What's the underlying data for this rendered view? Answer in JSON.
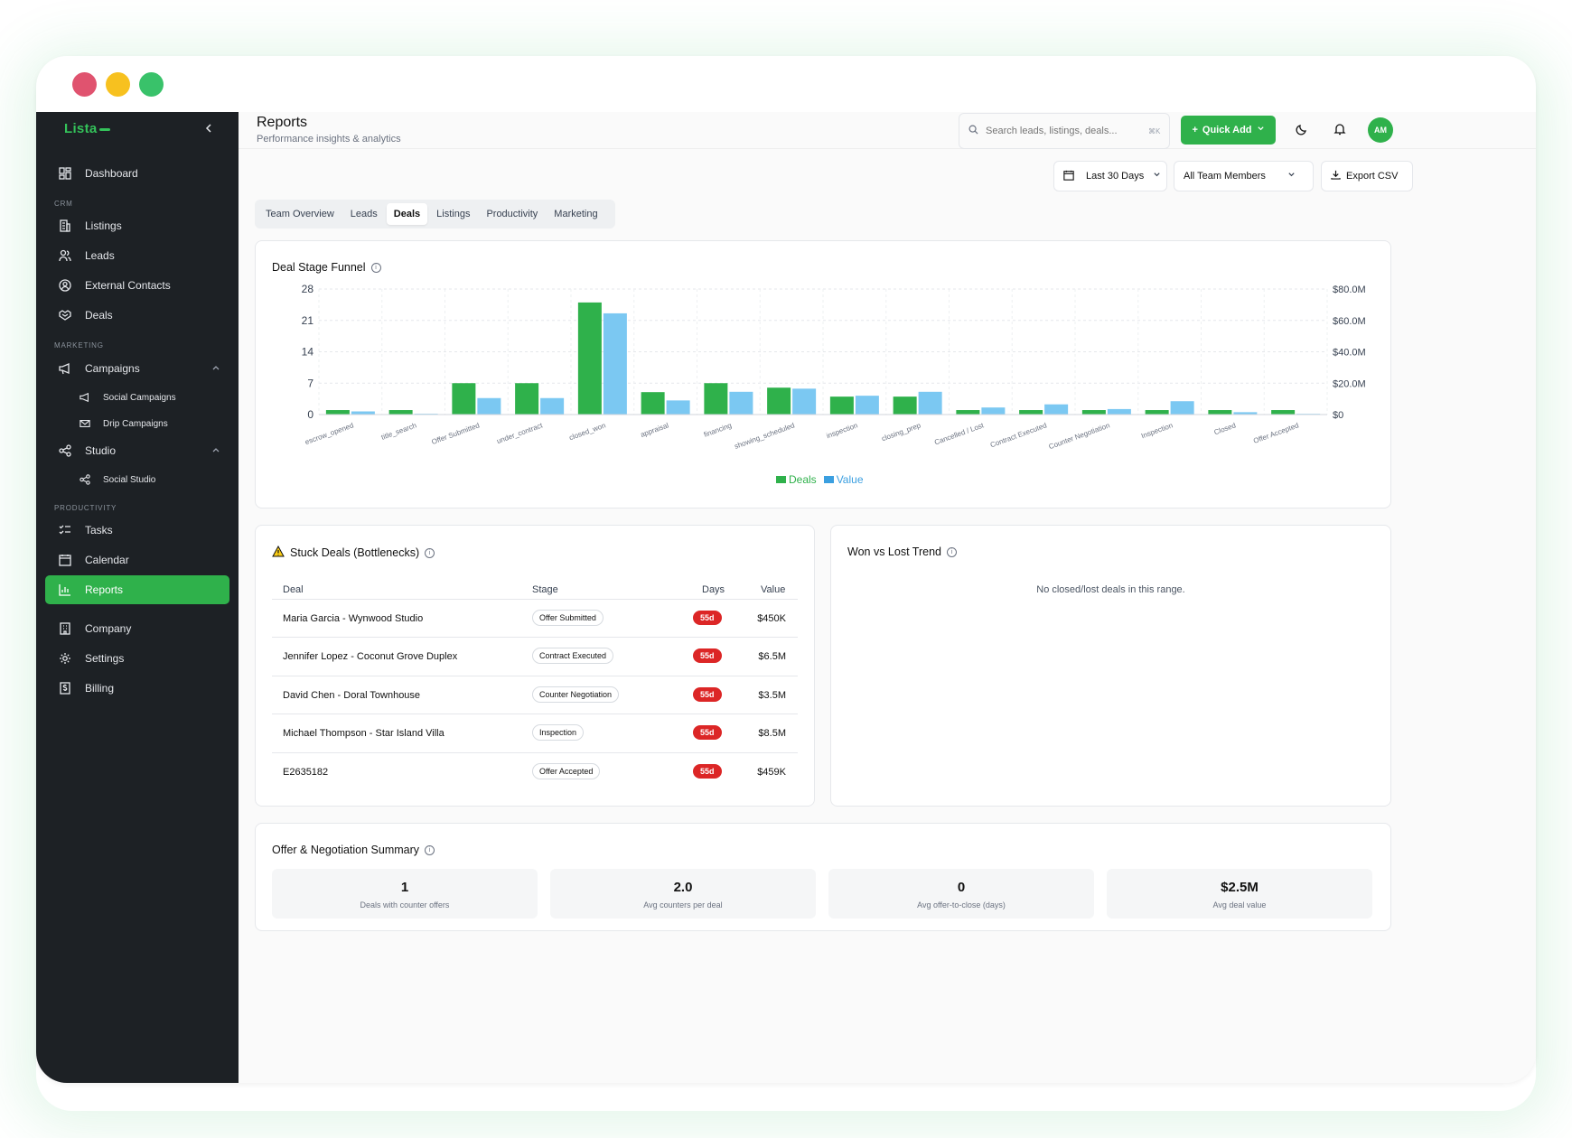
{
  "app": {
    "brand": "Lista"
  },
  "colors": {
    "accent": "#2fb14b",
    "deals": "#2fb14b",
    "value": "#7bc8f2",
    "danger": "#dc2626",
    "sidebar": "#1d2125"
  },
  "window_controls": [
    {
      "name": "close",
      "color": "#e0536f"
    },
    {
      "name": "minimize",
      "color": "#f7c11f"
    },
    {
      "name": "maximize",
      "color": "#39c26a"
    }
  ],
  "sidebar": {
    "items": [
      {
        "label": "Dashboard",
        "icon": "dashboard-icon"
      },
      {
        "section": "CRM"
      },
      {
        "label": "Listings",
        "icon": "building-icon"
      },
      {
        "label": "Leads",
        "icon": "users-icon"
      },
      {
        "label": "External Contacts",
        "icon": "contact-icon"
      },
      {
        "label": "Deals",
        "icon": "handshake-icon"
      },
      {
        "section": "MARKETING"
      },
      {
        "label": "Campaigns",
        "icon": "megaphone-icon"
      },
      {
        "label": "Social Campaigns",
        "icon": "megaphone-icon"
      },
      {
        "label": "Drip Campaigns",
        "icon": "mail-icon"
      },
      {
        "label": "Studio",
        "icon": "share-icon"
      },
      {
        "label": "Social Studio",
        "icon": "share-icon"
      },
      {
        "section": "PRODUCTIVITY"
      },
      {
        "label": "Tasks",
        "icon": "tasks-icon"
      },
      {
        "label": "Calendar",
        "icon": "calendar-icon"
      },
      {
        "label": "Reports",
        "icon": "bar-chart-icon",
        "active": true
      },
      {
        "label": "Company",
        "icon": "company-icon"
      },
      {
        "label": "Settings",
        "icon": "gear-icon"
      },
      {
        "label": "Billing",
        "icon": "billing-icon"
      }
    ]
  },
  "header": {
    "title": "Reports",
    "subtitle": "Performance insights & analytics",
    "search_placeholder": "Search leads, listings, deals...",
    "search_shortcut": "⌘K",
    "quick_add": "Quick Add",
    "avatar": "AM"
  },
  "filters": {
    "date_range": "Last 30 Days",
    "members": "All Team Members",
    "export": "Export CSV"
  },
  "tabs": [
    "Team Overview",
    "Leads",
    "Deals",
    "Listings",
    "Productivity",
    "Marketing"
  ],
  "active_tab": "Deals",
  "funnel": {
    "title": "Deal Stage Funnel",
    "chart_data": {
      "type": "bar",
      "categories": [
        "escrow_opened",
        "title_search",
        "Offer Submitted",
        "under_contract",
        "closed_won",
        "appraisal",
        "financing",
        "showing_scheduled",
        "inspection",
        "closing_prep",
        "Cancelled / Lost",
        "Contract Executed",
        "Counter Negotiation",
        "Inspection",
        "Closed",
        "Offer Accepted"
      ],
      "series": [
        {
          "name": "Deals",
          "axis": "left",
          "values": [
            1,
            1,
            7,
            7,
            25,
            5,
            7,
            6,
            4,
            4,
            1,
            1,
            1,
            1,
            1,
            1
          ]
        },
        {
          "name": "Value",
          "axis": "right",
          "values": [
            2.0,
            0.5,
            10.5,
            10.5,
            64.5,
            9.0,
            14.5,
            16.5,
            12.0,
            14.5,
            4.5,
            6.5,
            3.5,
            8.5,
            1.5,
            0.459
          ]
        }
      ],
      "y_left": {
        "ticks": [
          "0",
          "7",
          "14",
          "21",
          "28"
        ],
        "range": [
          0,
          28
        ]
      },
      "y_right": {
        "ticks": [
          "$0",
          "$20.0M",
          "$40.0M",
          "$60.0M",
          "$80.0M"
        ],
        "range": [
          0,
          80
        ]
      },
      "grid": true,
      "legend_position": "bottom"
    }
  },
  "stuck": {
    "title": "Stuck Deals (Bottlenecks)",
    "headers": {
      "deal": "Deal",
      "stage": "Stage",
      "days": "Days",
      "value": "Value"
    },
    "rows": [
      {
        "deal": "Maria Garcia - Wynwood Studio",
        "stage": "Offer Submitted",
        "days": "55d",
        "value": "$450K"
      },
      {
        "deal": "Jennifer Lopez - Coconut Grove Duplex",
        "stage": "Contract Executed",
        "days": "55d",
        "value": "$6.5M"
      },
      {
        "deal": "David Chen - Doral Townhouse",
        "stage": "Counter Negotiation",
        "days": "55d",
        "value": "$3.5M"
      },
      {
        "deal": "Michael Thompson - Star Island Villa",
        "stage": "Inspection",
        "days": "55d",
        "value": "$8.5M"
      },
      {
        "deal": "E2635182",
        "stage": "Offer Accepted",
        "days": "55d",
        "value": "$459K"
      }
    ]
  },
  "trend": {
    "title": "Won vs Lost Trend",
    "empty": "No closed/lost deals in this range."
  },
  "summary": {
    "title": "Offer & Negotiation Summary",
    "stats": [
      {
        "value": "1",
        "label": "Deals with counter offers"
      },
      {
        "value": "2.0",
        "label": "Avg counters per deal"
      },
      {
        "value": "0",
        "label": "Avg offer-to-close (days)"
      },
      {
        "value": "$2.5M",
        "label": "Avg deal value"
      }
    ]
  }
}
